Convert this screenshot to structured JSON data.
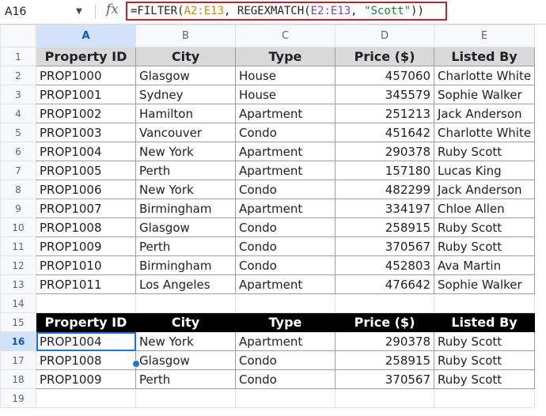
{
  "formula_bar": {
    "name_box": "A16",
    "fx": "fx",
    "formula_parts": [
      "=FILTER(",
      "A2:E13",
      ", REGEXMATCH(",
      "E2:E13",
      ", ",
      "\"Scott\"",
      "))"
    ]
  },
  "columns": [
    "A",
    "B",
    "C",
    "D",
    "E"
  ],
  "row_numbers": [
    "1",
    "2",
    "3",
    "4",
    "5",
    "6",
    "7",
    "8",
    "9",
    "10",
    "11",
    "12",
    "13",
    "14",
    "15",
    "16",
    "17",
    "18",
    "19"
  ],
  "table1": {
    "headers": [
      "Property ID",
      "City",
      "Type",
      "Price ($)",
      "Listed By"
    ],
    "rows": [
      [
        "PROP1000",
        "Glasgow",
        "House",
        "457060",
        "Charlotte White"
      ],
      [
        "PROP1001",
        "Sydney",
        "House",
        "345579",
        "Sophie Walker"
      ],
      [
        "PROP1002",
        "Hamilton",
        "Apartment",
        "251213",
        "Jack Anderson"
      ],
      [
        "PROP1003",
        "Vancouver",
        "Condo",
        "451642",
        "Charlotte White"
      ],
      [
        "PROP1004",
        "New York",
        "Apartment",
        "290378",
        "Ruby Scott"
      ],
      [
        "PROP1005",
        "Perth",
        "Apartment",
        "157180",
        "Lucas King"
      ],
      [
        "PROP1006",
        "New York",
        "Condo",
        "482299",
        "Jack Anderson"
      ],
      [
        "PROP1007",
        "Birmingham",
        "Apartment",
        "334197",
        "Chloe Allen"
      ],
      [
        "PROP1008",
        "Glasgow",
        "Condo",
        "258915",
        "Ruby Scott"
      ],
      [
        "PROP1009",
        "Perth",
        "Condo",
        "370567",
        "Ruby Scott"
      ],
      [
        "PROP1010",
        "Birmingham",
        "Condo",
        "452803",
        "Ava Martin"
      ],
      [
        "PROP1011",
        "Los Angeles",
        "Apartment",
        "476642",
        "Sophie Walker"
      ]
    ]
  },
  "table2": {
    "headers": [
      "Property ID",
      "City",
      "Type",
      "Price ($)",
      "Listed By"
    ],
    "rows": [
      [
        "PROP1004",
        "New York",
        "Apartment",
        "290378",
        "Ruby Scott"
      ],
      [
        "PROP1008",
        "Glasgow",
        "Condo",
        "258915",
        "Ruby Scott"
      ],
      [
        "PROP1009",
        "Perth",
        "Condo",
        "370567",
        "Ruby Scott"
      ]
    ]
  },
  "colors": {
    "selection": "#1a73e8",
    "formula_border": "#c0232b",
    "header1_bg": "#d9d9d9",
    "header2_bg": "#000000"
  }
}
